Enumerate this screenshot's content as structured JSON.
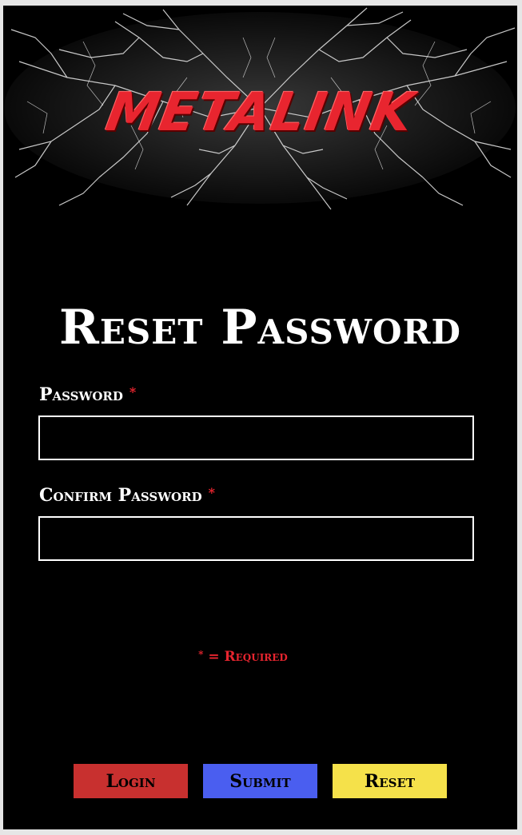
{
  "banner": {
    "logo_text": "METALINK",
    "logo_color": "#e8252f"
  },
  "page": {
    "title": "Reset Password"
  },
  "form": {
    "password": {
      "label": "Password",
      "required_mark": "*",
      "value": ""
    },
    "confirm_password": {
      "label": "Confirm Password",
      "required_mark": "*",
      "value": ""
    },
    "required_note": {
      "star": "*",
      "text": " = Required"
    }
  },
  "buttons": {
    "login": "Login",
    "submit": "Submit",
    "reset": "Reset"
  },
  "colors": {
    "background": "#000000",
    "login_button": "#c8302f",
    "submit_button": "#4a5ef0",
    "reset_button": "#f5e14a",
    "required_red": "#e8252f"
  }
}
